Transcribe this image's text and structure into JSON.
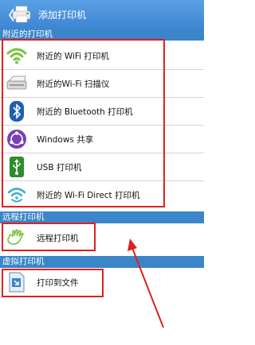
{
  "header": {
    "title": "添加打印机",
    "back_glyph": "〈"
  },
  "sections": {
    "nearby": "附近的打印机",
    "remote": "远程打印机",
    "virtual": "虚拟打印机"
  },
  "nearby_items": [
    {
      "label": "附近的 WiFi 打印机",
      "icon": "wifi-icon"
    },
    {
      "label": "附近的Wi-Fi 扫描仪",
      "icon": "scanner-icon"
    },
    {
      "label": "附近的 Bluetooth 打印机",
      "icon": "bluetooth-icon"
    },
    {
      "label": "Windows 共享",
      "icon": "windows-share-icon"
    },
    {
      "label": "USB 打印机",
      "icon": "usb-icon"
    },
    {
      "label": "附近的 Wi-Fi Direct 打印机",
      "icon": "wifi-direct-icon"
    }
  ],
  "remote_items": [
    {
      "label": "远程打印机",
      "icon": "hand-icon"
    }
  ],
  "virtual_items": [
    {
      "label": "打印到文件",
      "icon": "file-arrow-icon"
    }
  ],
  "colors": {
    "header": "#4a93dc",
    "section": "#3a86c8",
    "annotation": "#e02020"
  }
}
